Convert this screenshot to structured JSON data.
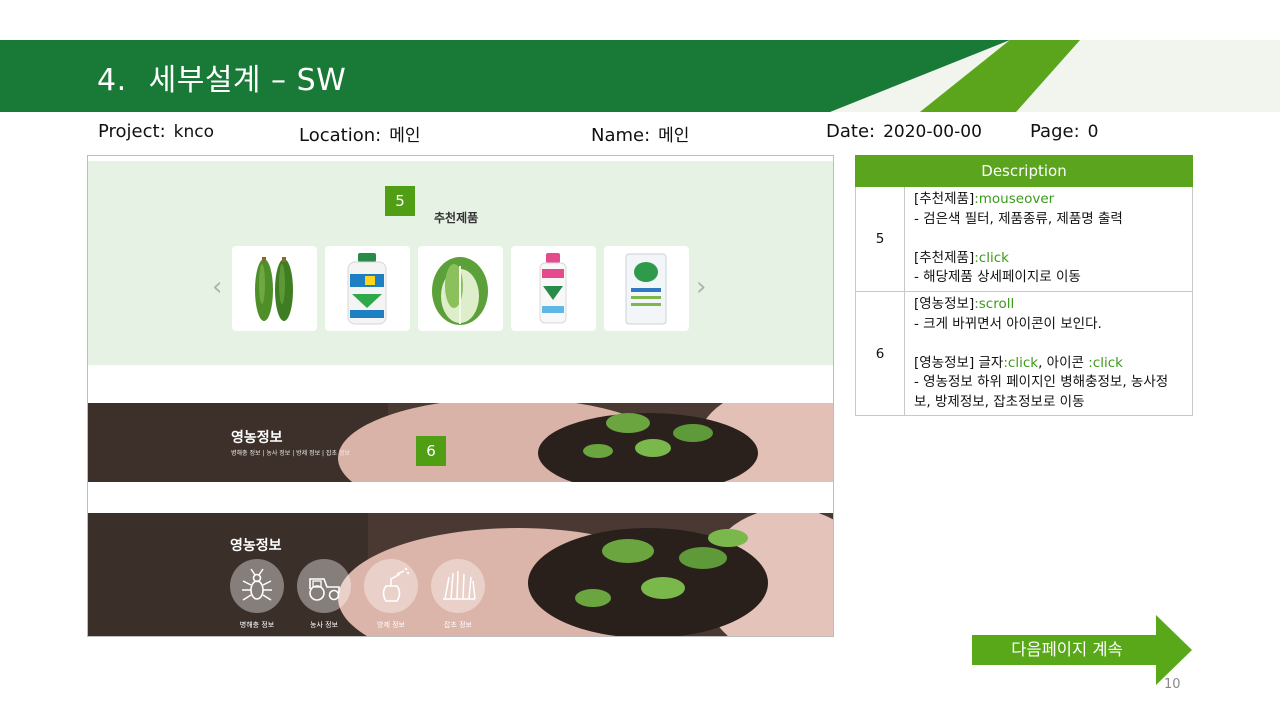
{
  "header": {
    "number": "4.",
    "title": "세부설계 – SW"
  },
  "meta": {
    "project": {
      "label": "Project:",
      "value": "knco"
    },
    "location": {
      "label": "Location:",
      "value": "메인"
    },
    "name": {
      "label": "Name:",
      "value": "메인"
    },
    "date": {
      "label": "Date:",
      "value": "2020-00-00"
    },
    "page": {
      "label": "Page:",
      "value": "0"
    }
  },
  "mockup": {
    "recommend": {
      "badge": "5",
      "title": "추천제품",
      "prev_icon": "chevron-left-icon",
      "next_icon": "chevron-right-icon",
      "products": [
        "cucumber-image",
        "pesticide-bottle-image",
        "cabbage-image",
        "pink-bottle-image",
        "fertilizer-bag-image"
      ]
    },
    "banner_scrolled": {
      "badge": "6",
      "title": "영농정보",
      "subtitle": "병해충 정보 | 농사 정보 | 방제 정보 | 잡초 정보"
    },
    "banner_expanded": {
      "title": "영농정보",
      "icons": [
        {
          "icon": "bug-icon",
          "label": "병해충 정보"
        },
        {
          "icon": "tractor-icon",
          "label": "농사 정보"
        },
        {
          "icon": "sprayer-icon",
          "label": "방제 정보"
        },
        {
          "icon": "grass-icon",
          "label": "잡초 정보"
        }
      ]
    }
  },
  "description": {
    "header": "Description",
    "rows": [
      {
        "no": "5",
        "a_title": "[추천제품]",
        "a_event": ":mouseover",
        "a_text": "-   검은색 필터, 제품종류, 제품명 출력",
        "b_title": "[추천제품]",
        "b_event": ":click",
        "b_text": "- 해당제품 상세페이지로 이동"
      },
      {
        "no": "6",
        "a_title": "[영농정보]",
        "a_event": ":scroll",
        "a_text": "-   크게 바뀌면서 아이콘이 보인다.",
        "b_title": "[영농정보] 글자",
        "b_event": ":click",
        "b_mid": ", 아이콘",
        "b_event2": ":click",
        "b_text": "- 영농정보 하위 페이지인 병해충정보, 농사정보, 방제정보, 잡초정보로 이동"
      }
    ]
  },
  "next_button": "다음페이지 계속",
  "slide_number": "10",
  "colors": {
    "brand_dark": "#187a36",
    "brand_light": "#5aa51d",
    "section_bg": "#e6f2e3"
  }
}
